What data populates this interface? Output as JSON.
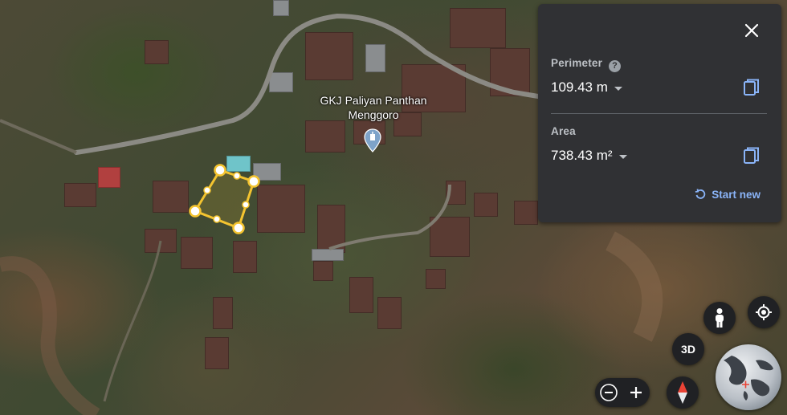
{
  "map": {
    "place_label": "GKJ Paliyan Panthan Menggoro",
    "place_pin_icon": "church-pin-icon"
  },
  "measurement_panel": {
    "perimeter_label": "Perimeter",
    "perimeter_value": "109.43 m",
    "area_label": "Area",
    "area_value": "738.43 m²",
    "start_new_label": "Start new",
    "help_icon_glyph": "?",
    "accent_color": "#8ab4f8",
    "polygon_color": "#f4c430"
  },
  "controls": {
    "btn_3d_label": "3D",
    "zoom_out_glyph": "−",
    "zoom_in_glyph": "+"
  }
}
